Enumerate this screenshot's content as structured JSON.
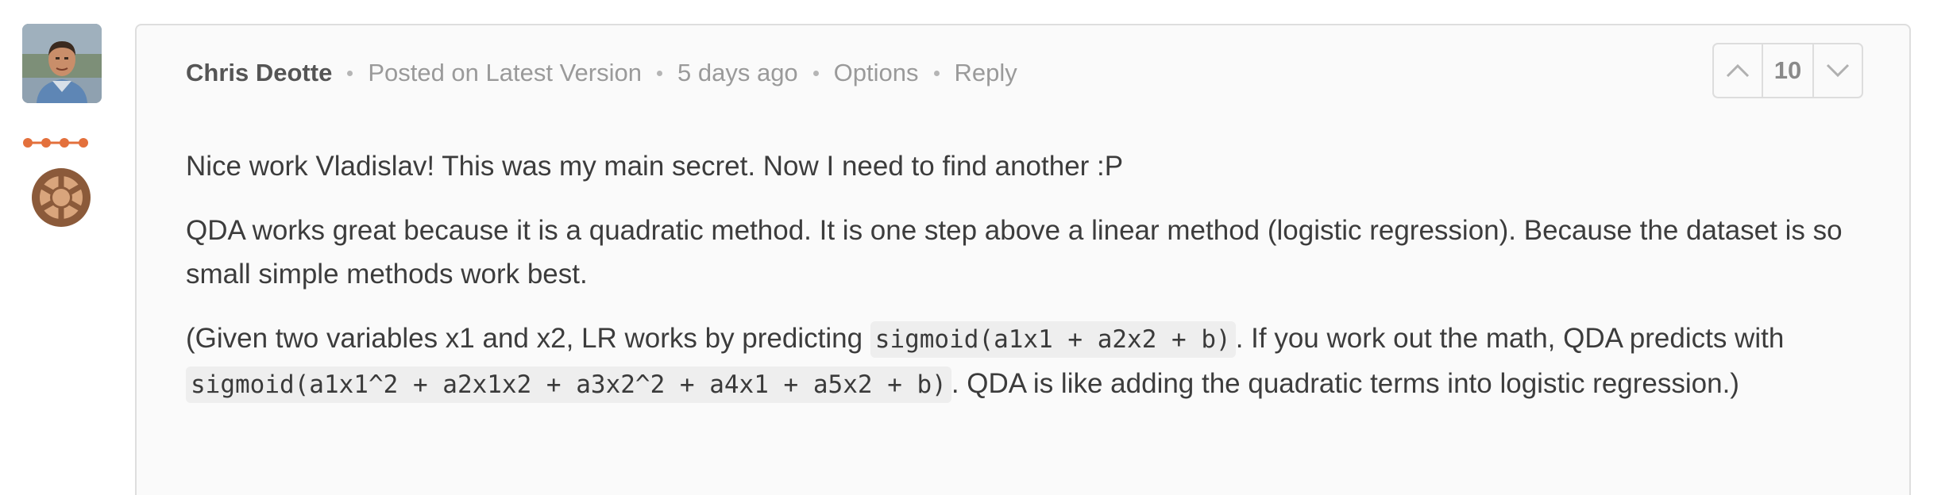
{
  "comment": {
    "author": "Chris Deotte",
    "posted_on": "Posted on Latest Version",
    "time_ago": "5 days ago",
    "options_label": "Options",
    "reply_label": "Reply",
    "vote_count": "10",
    "paragraphs": [
      {
        "text": "Nice work Vladislav! This was my main secret. Now I need to find another :P"
      },
      {
        "text": "QDA works great because it is a quadratic method. It is one step above a linear method (logistic regression). Because the dataset is so small simple methods work best."
      },
      {
        "part1": "(Given two variables x1 and x2, LR works by predicting ",
        "code1": "sigmoid(a1x1 + a2x2 + b)",
        "part2": ". If you work out the math, QDA predicts with ",
        "code2": "sigmoid(a1x1^2 + a2x1x2 + a3x2^2 + a4x1 + a5x2 + b)",
        "part3": ". QDA is like adding the quadratic terms into logistic regression.)"
      }
    ]
  },
  "icons": {
    "upvote": "chevron-up-icon",
    "downvote": "chevron-down-icon",
    "tier": "tier-dots-icon",
    "medal": "medal-badge-icon"
  },
  "colors": {
    "tier_orange": "#e3703c",
    "badge_bronze": "#8b5a3a",
    "badge_light": "#d9a57c"
  }
}
